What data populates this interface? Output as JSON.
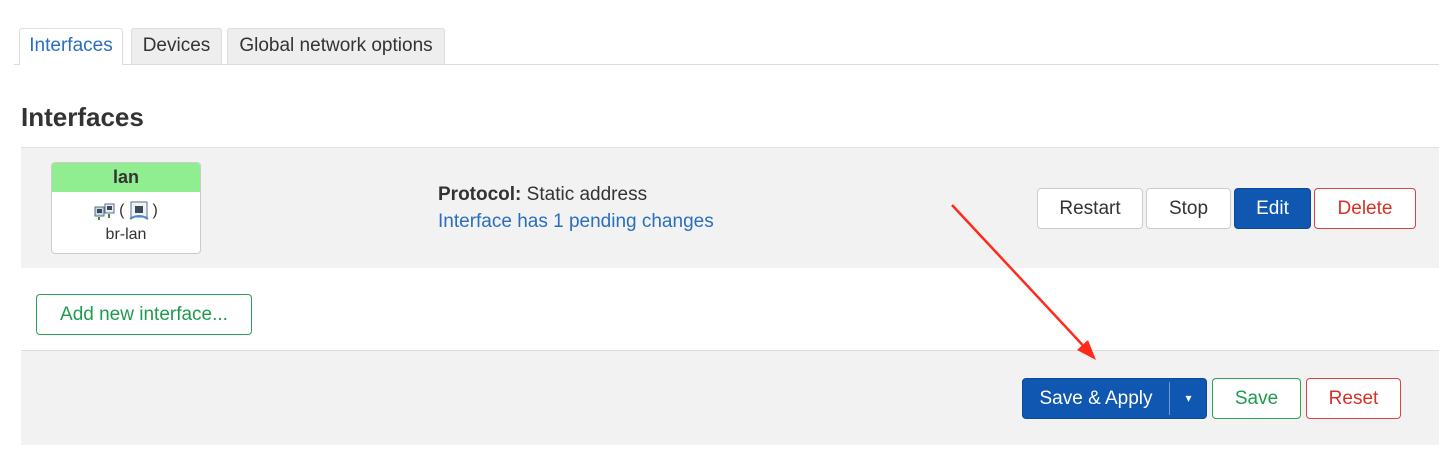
{
  "tabs": [
    {
      "label": "Interfaces",
      "active": true
    },
    {
      "label": "Devices",
      "active": false
    },
    {
      "label": "Global network options",
      "active": false
    }
  ],
  "page_title": "Interfaces",
  "interface": {
    "name": "lan",
    "icons": [
      "bridge-icon",
      "ethernet-port-icon"
    ],
    "icon_paren_open": "(",
    "icon_paren_close": ")",
    "device": "br-lan",
    "protocol_label": "Protocol:",
    "protocol_value": "Static address",
    "pending_text": "Interface has 1 pending changes",
    "badge_color": "#90ee90",
    "actions": {
      "restart": "Restart",
      "stop": "Stop",
      "edit": "Edit",
      "delete": "Delete"
    }
  },
  "add_interface_label": "Add new interface...",
  "footer": {
    "save_apply": "Save & Apply",
    "dropdown_caret": "▾",
    "save": "Save",
    "reset": "Reset"
  },
  "colors": {
    "accent": "#0f57b0",
    "link": "#2a6fbf",
    "danger": "#d93025",
    "success": "#1f9a4e",
    "annotation_arrow": "#ff2a1a"
  }
}
